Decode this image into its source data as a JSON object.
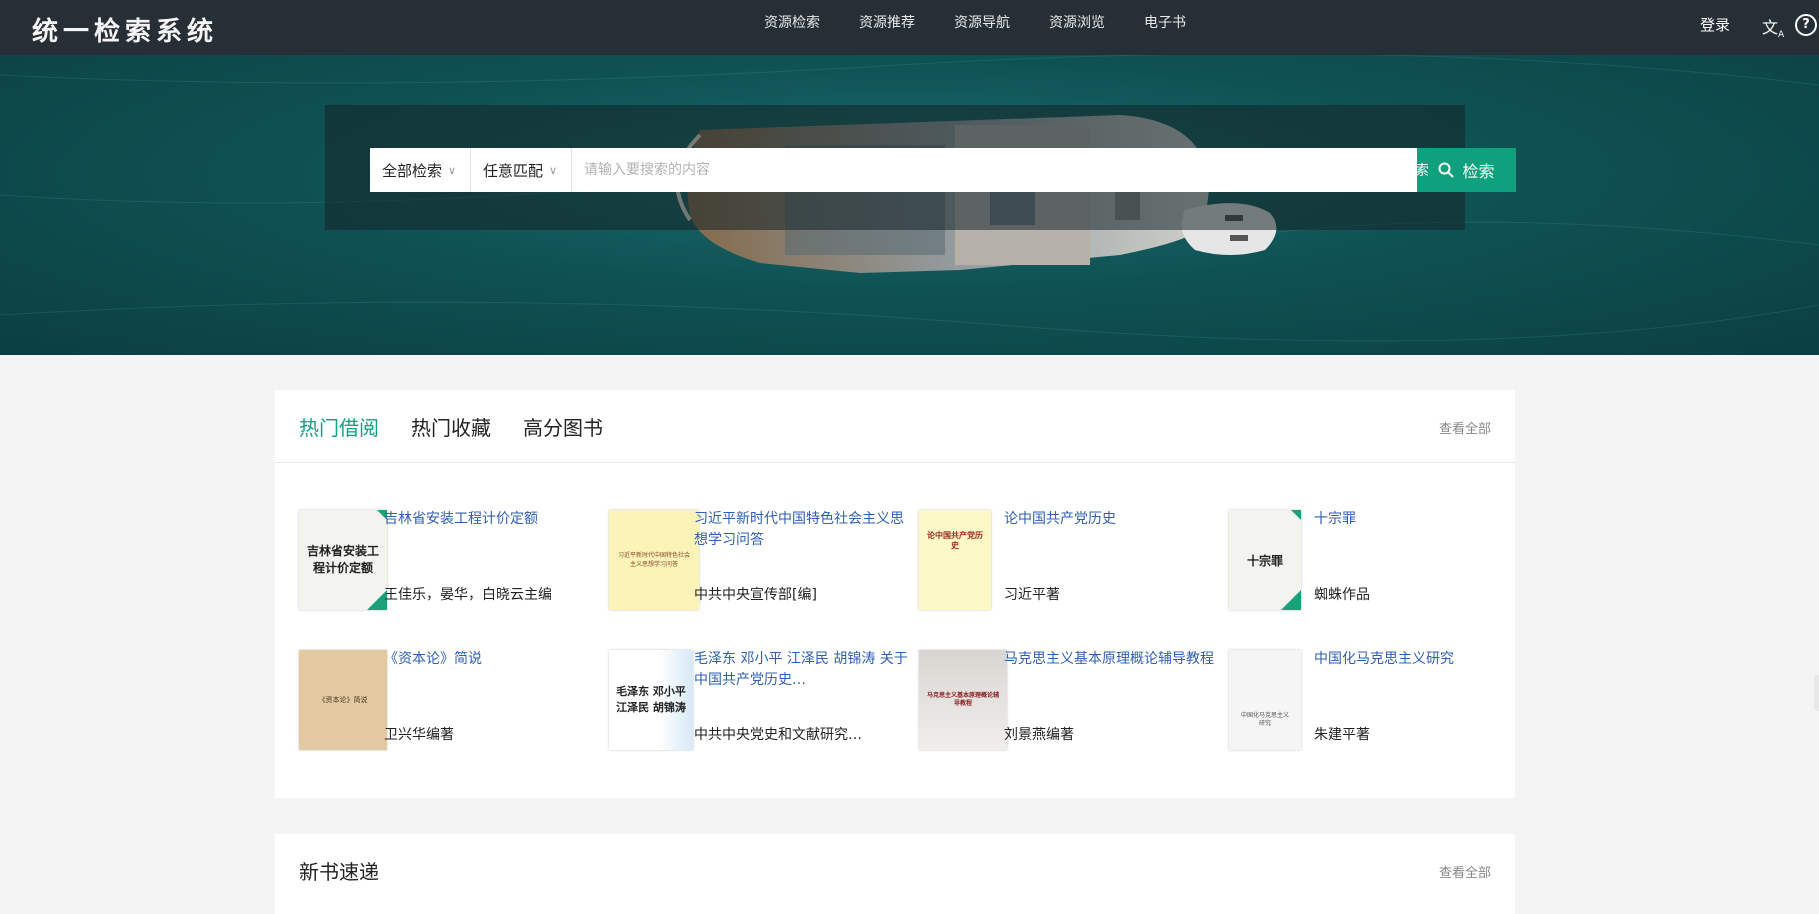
{
  "header": {
    "brand": "统一检索系统",
    "nav": [
      "资源检索",
      "资源推荐",
      "资源导航",
      "资源浏览",
      "电子书"
    ],
    "login": "登录",
    "lang_icon": "translate-icon",
    "help_icon": "help-icon"
  },
  "search": {
    "scope": "全部检索",
    "match": "任意匹配",
    "placeholder": "请输入要搜索的内容",
    "button": "检索",
    "advanced": "高级检索"
  },
  "hot": {
    "tabs": [
      "热门借阅",
      "热门收藏",
      "高分图书"
    ],
    "view_all": "查看全部",
    "books": [
      {
        "title": "吉林省安装工程计价定额",
        "author": "王佳乐，晏华，白晓云主编",
        "cover_text": "吉林省安装工程计价定额"
      },
      {
        "title": "习近平新时代中国特色社会主义思想学习问答",
        "author": "中共中央宣传部[编]",
        "cover_text": "习近平新时代中国特色社会主义思想学习问答"
      },
      {
        "title": "论中国共产党历史",
        "author": "习近平著",
        "cover_text": "论中国共产党历史"
      },
      {
        "title": "十宗罪",
        "author": "蜘蛛作品",
        "cover_text": "十宗罪"
      },
      {
        "title": "《资本论》简说",
        "author": "卫兴华编著",
        "cover_text": "《资本论》简说"
      },
      {
        "title": "毛泽东 邓小平 江泽民 胡锦涛 关于中国共产党历史…",
        "author": "中共中央党史和文献研究…",
        "cover_text": "毛泽东 邓小平 江泽民 胡锦涛"
      },
      {
        "title": "马克思主义基本原理概论辅导教程",
        "author": "刘景燕编著",
        "cover_text": "马克思主义基本原理概论辅导教程"
      },
      {
        "title": "中国化马克思主义研究",
        "author": "朱建平著",
        "cover_text": "中国化马克思主义研究"
      }
    ]
  },
  "new_books": {
    "title": "新书速递",
    "view_all": "查看全部"
  }
}
